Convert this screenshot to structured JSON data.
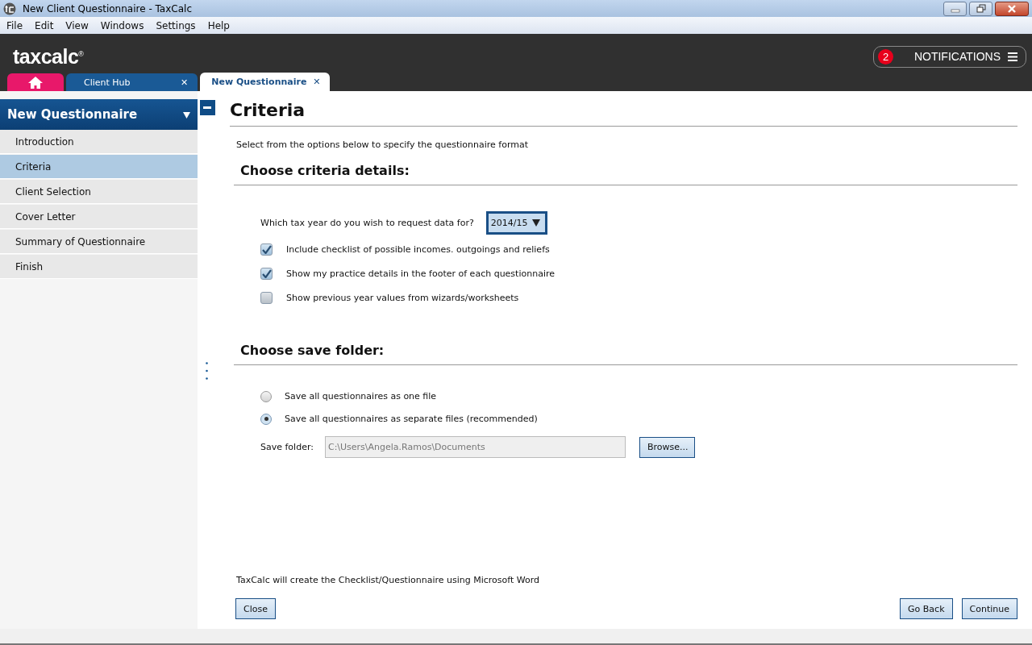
{
  "window": {
    "title": "New Client Questionnaire - TaxCalc"
  },
  "menu": [
    "File",
    "Edit",
    "View",
    "Windows",
    "Settings",
    "Help"
  ],
  "header": {
    "logo": "taxcalc$^{®}$",
    "notifications": {
      "count": "2",
      "label": "NOTIFICATIONS"
    }
  },
  "tabs": [
    {
      "kind": "home",
      "selected": false
    },
    {
      "kind": "text",
      "label": "Client Hub",
      "close": "✕",
      "selected": false
    },
    {
      "kind": "text",
      "label": "New Questionnaire",
      "close": "✕",
      "selected": true
    }
  ],
  "sidebar": {
    "title": "New Questionnaire",
    "items": [
      {
        "label": "Introduction",
        "selected": false
      },
      {
        "label": "Criteria",
        "selected": true
      },
      {
        "label": "Client Selection",
        "selected": false
      },
      {
        "label": "Cover Letter",
        "selected": false
      },
      {
        "label": "Summary of Questionnaire",
        "selected": false
      },
      {
        "label": "Finish",
        "selected": false
      }
    ]
  },
  "page": {
    "title": "Criteria",
    "intro": "Select from the options below to specify the questionnaire format",
    "criteria": {
      "heading": "Choose criteria details:",
      "question": "Which tax year do you wish to request data for?",
      "tax_year": "2014/15",
      "options": [
        {
          "label": "Include checklist of possible incomes. outgoings and reliefs",
          "checked": true
        },
        {
          "label": "Show my practice details in the footer of each questionnaire",
          "checked": true
        },
        {
          "label": "Show previous year values from wizards/worksheets",
          "checked": false
        }
      ]
    },
    "save": {
      "heading": "Choose save folder:",
      "options": [
        {
          "label": "Save all questionnaires as one file",
          "selected": false
        },
        {
          "label": "Save all questionnaires as separate files (recommended)",
          "selected": true
        }
      ],
      "folder_label": "Save folder:",
      "folder": "C:\\Users\\Angela.Ramos\\Documents",
      "browse": "Browse..."
    },
    "note": "TaxCalc will create the Checklist/Questionnaire using Microsoft Word",
    "buttons": {
      "close": "Close",
      "back": "Go Back",
      "continue": "Continue"
    }
  }
}
